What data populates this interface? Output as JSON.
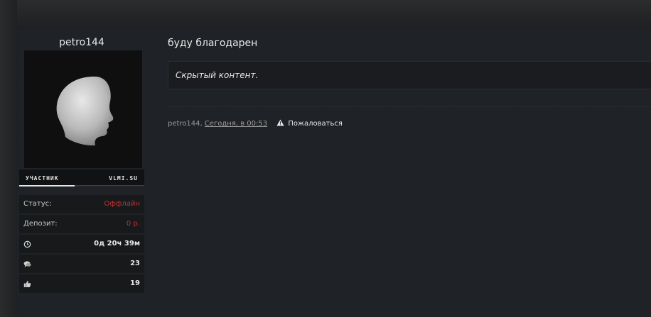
{
  "post": {
    "author": "petro144",
    "title": "буду благодарен",
    "hidden_content": "Скрытый контент.",
    "meta_author": "petro144,",
    "meta_date": "Сегодня, в 00:53",
    "report_label": "Пожаловаться"
  },
  "user": {
    "rank_left": "УЧАСТНИК",
    "rank_right": "VLMI.SU",
    "stats": {
      "status_label": "Статус:",
      "status_value": "Оффлайн",
      "deposit_label": "Депозит:",
      "deposit_value": "0 р.",
      "online_time": "0д 20ч 39м",
      "messages": "23",
      "likes": "19"
    }
  },
  "icons": {
    "online_time": "clock-icon",
    "messages": "chat-icon",
    "likes": "thumbs-up-icon",
    "report": "warning-icon"
  },
  "colors": {
    "offline": "#b83434",
    "background": "#1f2226"
  }
}
